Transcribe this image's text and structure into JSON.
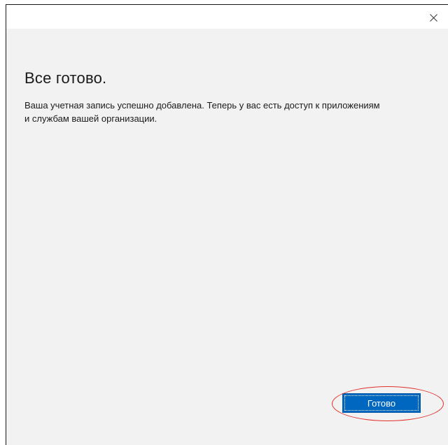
{
  "dialog": {
    "heading": "Все готово.",
    "message_line1": "Ваша учетная запись успешно добавлена. Теперь у вас есть доступ к приложениям",
    "message_line2": "и службам вашей организации.",
    "done_label": "Готово",
    "close_icon": "close-icon"
  },
  "colors": {
    "accent": "#0067c0",
    "highlight": "#e0312b",
    "background": "#f2f2f2"
  }
}
